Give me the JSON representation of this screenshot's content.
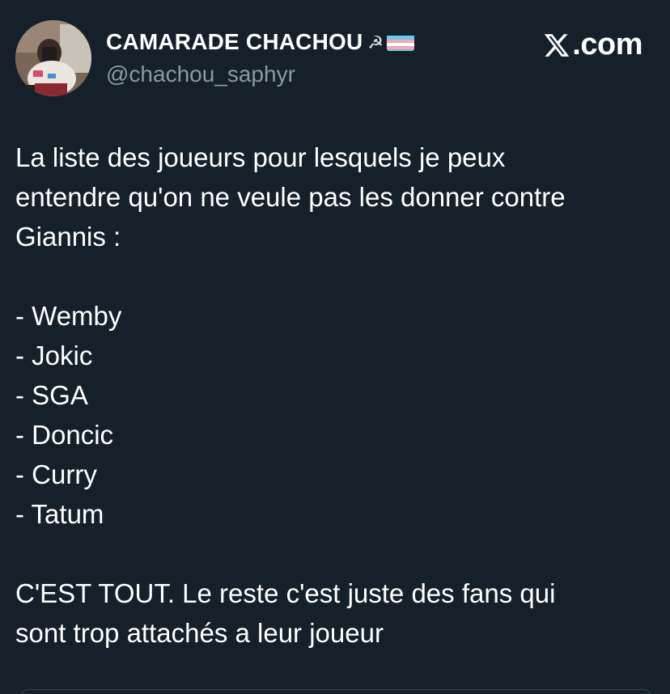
{
  "author": {
    "display_name": "CAMARADE CHACHOU",
    "name_emojis": {
      "sickle": "☭",
      "flag_icon": "transgender-flag-icon"
    },
    "handle": "@chachou_saphyr",
    "avatar_icon": "profile-photo"
  },
  "source": {
    "logo_icon": "x-logo-icon",
    "label": ".com"
  },
  "tweet": {
    "intro_lines": [
      "La liste des joueurs pour lesquels je peux",
      "entendre qu'on ne veule pas les donner contre",
      "Giannis :"
    ],
    "players": [
      "- Wemby",
      "- Jokic",
      "- SGA",
      "- Doncic",
      "- Curry",
      "- Tatum"
    ],
    "closing_lines": [
      "C'EST TOUT. Le reste c'est juste des fans qui",
      "sont trop attachés a leur joueur"
    ]
  },
  "colors": {
    "background": "#15202b",
    "text": "#ffffff",
    "secondary_text": "#8b98a5",
    "flag_blue": "#5bcefa",
    "flag_pink": "#f5a9b8",
    "flag_white": "#ffffff"
  }
}
